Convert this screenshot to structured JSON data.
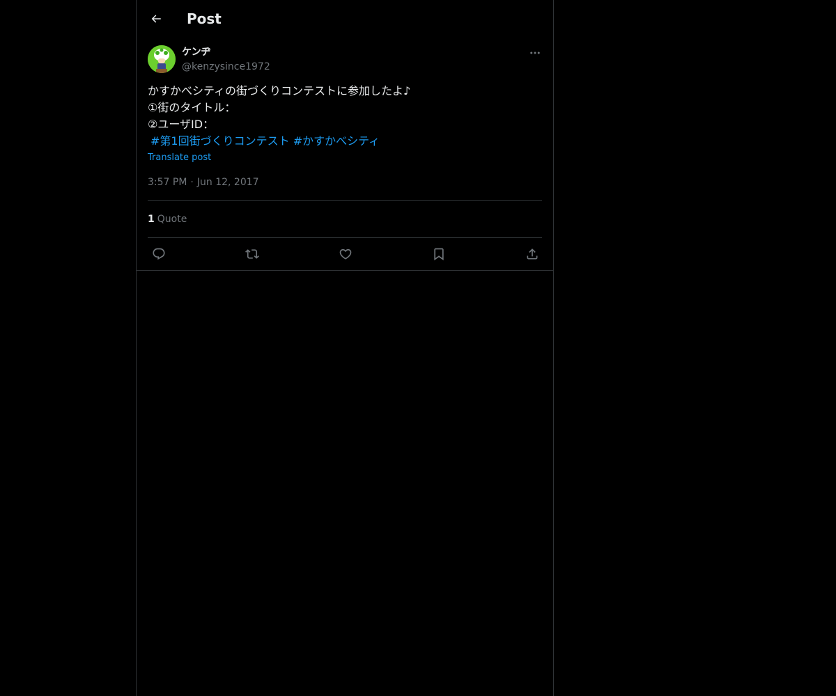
{
  "header": {
    "back_icon": "arrow-left-icon",
    "title": "Post"
  },
  "author": {
    "display_name": "ケンヂ",
    "handle": "@kenzysince1972",
    "avatar_icon": "avatar-mushroom-character"
  },
  "post": {
    "lines": [
      "かすかべシティの街づくりコンテストに参加したよ♪",
      "①街のタイトル：",
      "②ユーザID："
    ],
    "hashtags": [
      "#第1回街づくりコンテスト",
      "#かすかべシティ"
    ],
    "translate_label": "Translate post",
    "time": "3:57 PM",
    "separator": "·",
    "date": "Jun 12, 2017"
  },
  "stats": {
    "quote_count": "1",
    "quote_label": "Quote"
  },
  "actions": [
    "reply-icon",
    "repost-icon",
    "like-icon",
    "bookmark-icon",
    "share-icon"
  ],
  "colors": {
    "background": "#000000",
    "text": "#e7e9ea",
    "muted": "#71767b",
    "accent": "#1d9bf0",
    "border": "#2f3336"
  }
}
